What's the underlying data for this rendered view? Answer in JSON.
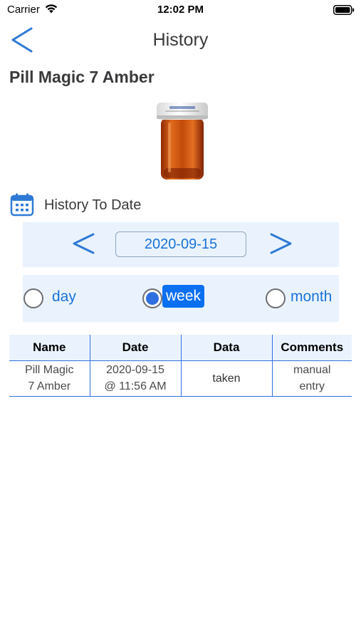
{
  "status_bar": {
    "carrier": "Carrier",
    "time": "12:02 PM"
  },
  "nav": {
    "title": "History",
    "back_icon": "chevron-left-icon"
  },
  "medication": {
    "name": "Pill Magic 7 Amber",
    "image_icon": "amber-pill-bottle"
  },
  "history_section": {
    "icon": "calendar-icon",
    "label": "History To Date"
  },
  "date_picker": {
    "value": "2020-09-15",
    "prev_icon": "chevron-left-icon",
    "next_icon": "chevron-right-icon"
  },
  "range": {
    "options": [
      {
        "label": "day",
        "selected": false
      },
      {
        "label": "week",
        "selected": true
      },
      {
        "label": "month",
        "selected": false
      }
    ]
  },
  "table": {
    "headers": [
      "Name",
      "Date",
      "Data",
      "Comments"
    ],
    "rows": [
      {
        "name_line1": "Pill Magic",
        "name_line2": "7 Amber",
        "date_line1": "2020-09-15",
        "date_line2": "@ 11:56 AM",
        "data": "taken",
        "comments_line1": "manual",
        "comments_line2": "entry"
      }
    ]
  },
  "colors": {
    "accent": "#1a73d9",
    "selected_bg": "#0a6ff0",
    "panel_bg": "#eaf3fd",
    "table_rule": "#2f6fe0",
    "bottle_amber": "#d35400"
  }
}
